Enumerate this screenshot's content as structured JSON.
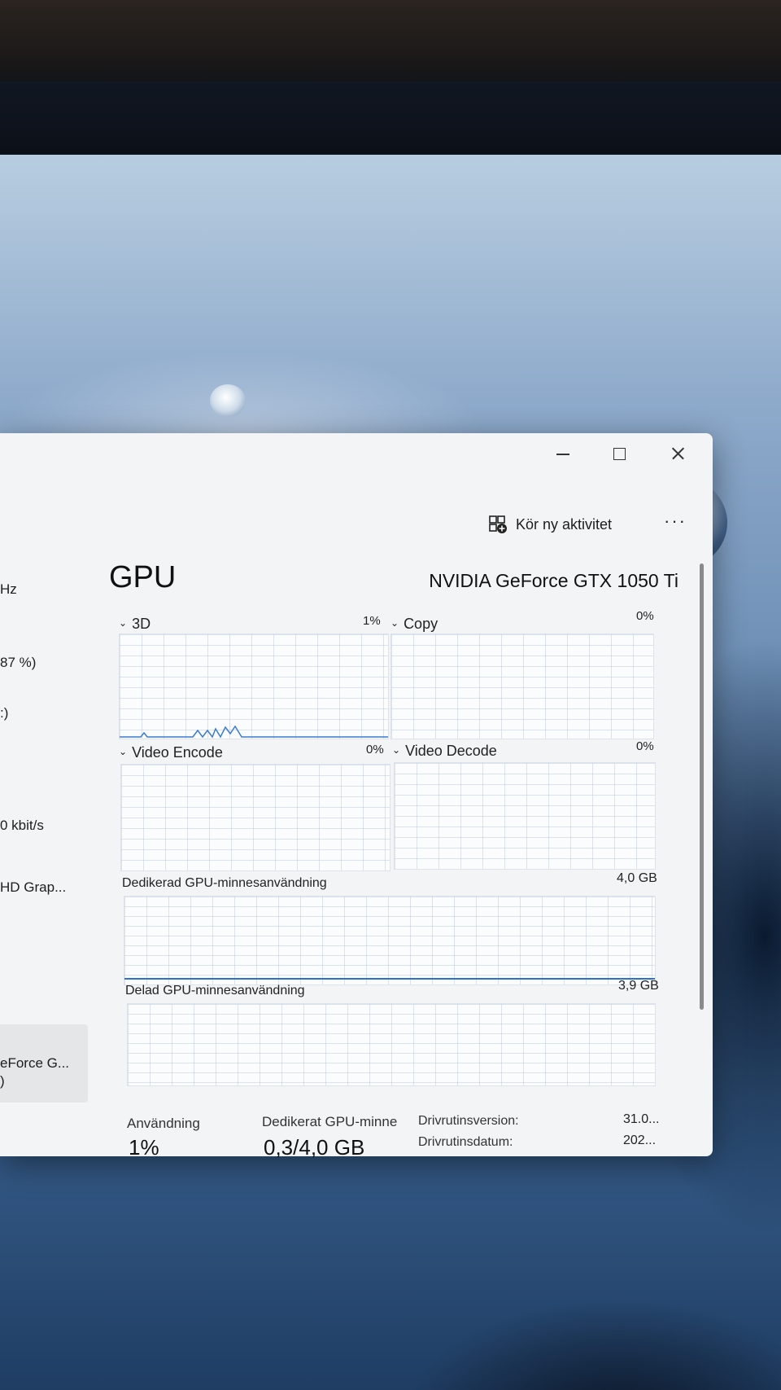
{
  "window": {
    "controls": {
      "minimize": "minimize",
      "maximize": "maximize",
      "close": "close"
    }
  },
  "command_bar": {
    "run_new_task": "Kör ny aktivitet",
    "more": "···"
  },
  "sidebar": {
    "fragments": [
      "Hz",
      "87 %)",
      ":)",
      "0 kbit/s",
      "HD Grap...",
      "eForce G...",
      ")"
    ]
  },
  "main": {
    "title": "GPU",
    "device_name": "NVIDIA GeForce GTX 1050 Ti",
    "engines": [
      {
        "label": "3D",
        "percent": "1%"
      },
      {
        "label": "Copy",
        "percent": "0%"
      },
      {
        "label": "Video Encode",
        "percent": "0%"
      },
      {
        "label": "Video Decode",
        "percent": "0%"
      }
    ],
    "dedicated_memory": {
      "label": "Dedikerad GPU-minnesanvändning",
      "max": "4,0 GB"
    },
    "shared_memory": {
      "label": "Delad GPU-minnesanvändning",
      "max": "3,9 GB"
    },
    "stats": {
      "usage_label": "Användning",
      "usage_value": "1%",
      "dedicated_label": "Dedikerat GPU-minne",
      "dedicated_value": "0,3/4,0 GB",
      "driver_version_label": "Drivrutinsversion:",
      "driver_version_value": "31.0...",
      "driver_date_label": "Drivrutinsdatum:",
      "driver_date_value": "202..."
    }
  },
  "colors": {
    "accent_line": "#2e72c8",
    "window_bg": "#f3f4f5"
  }
}
